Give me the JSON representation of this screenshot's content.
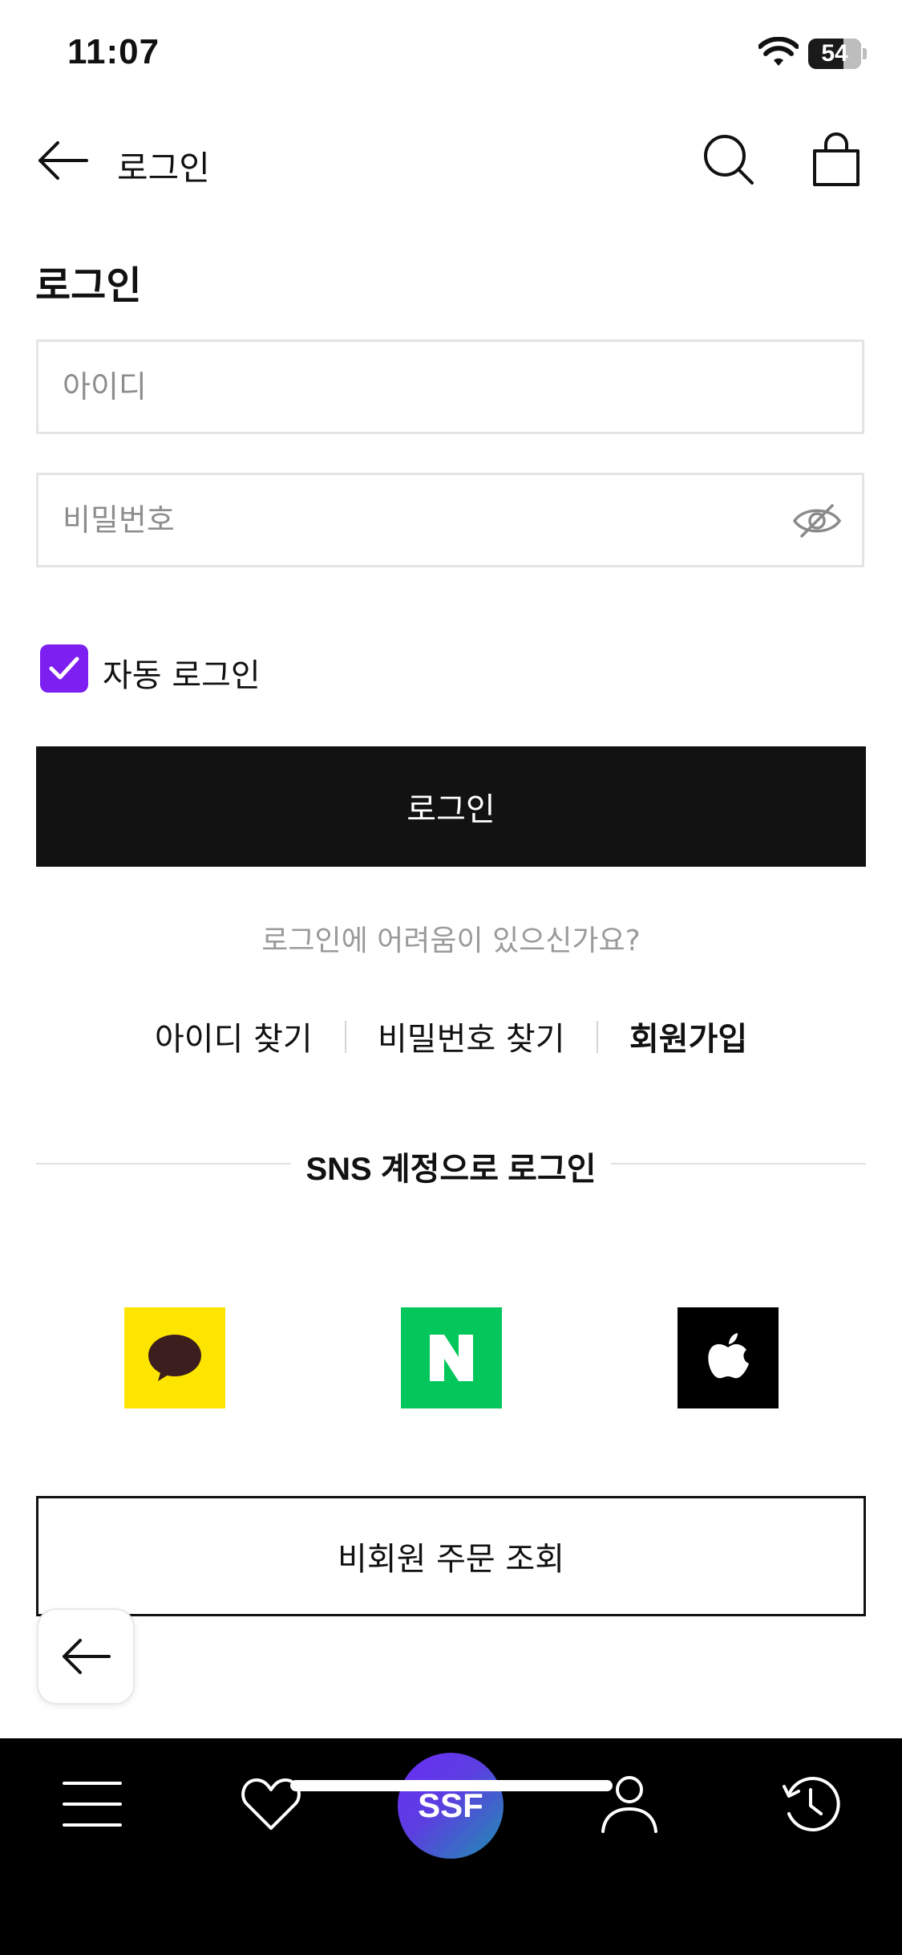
{
  "status_bar": {
    "time": "11:07",
    "battery": "54"
  },
  "header": {
    "title": "로그인"
  },
  "page_title": "로그인",
  "form": {
    "id_placeholder": "아이디",
    "id_value": "",
    "password_placeholder": "비밀번호",
    "password_value": "",
    "auto_login_label": "자동 로그인",
    "auto_login_checked": true,
    "login_button": "로그인"
  },
  "help_text": "로그인에 어려움이 있으신가요?",
  "links": {
    "find_id": "아이디 찾기",
    "find_password": "비밀번호 찾기",
    "signup": "회원가입"
  },
  "sns": {
    "title": "SNS 계정으로 로그인",
    "providers": [
      {
        "icon": "kakao-icon",
        "color": "#fee500"
      },
      {
        "icon": "naver-icon",
        "color": "#03c75a"
      },
      {
        "icon": "apple-icon",
        "color": "#000000"
      }
    ]
  },
  "guest_order_button": "비회원 주문 조회",
  "tab_bar": {
    "items": [
      {
        "icon": "menu-icon"
      },
      {
        "icon": "heart-icon"
      },
      {
        "icon": "ssf-logo",
        "label": "SSF"
      },
      {
        "icon": "user-icon"
      },
      {
        "icon": "history-icon"
      }
    ]
  },
  "colors": {
    "accent": "#7d1ff0",
    "button": "#121212",
    "tab_bar": "#000000"
  }
}
